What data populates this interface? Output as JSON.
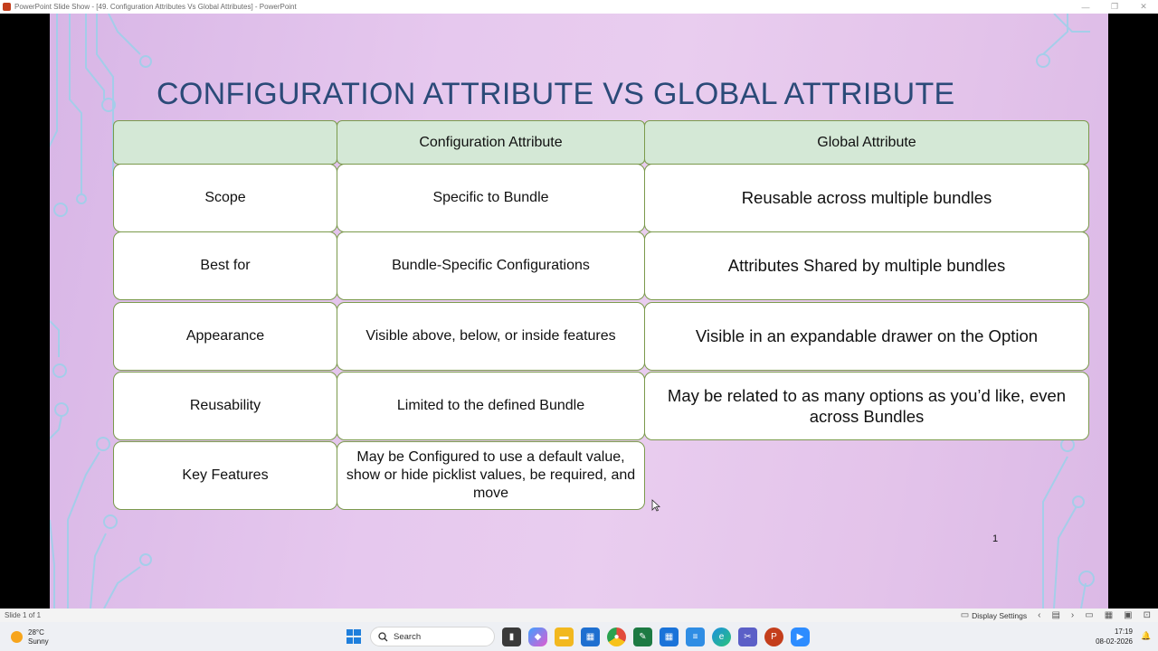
{
  "window": {
    "title": "PowerPoint Slide Show - [49. Configuration Attributes Vs Global Attributes] - PowerPoint",
    "min": "—",
    "max": "❐",
    "close": "✕"
  },
  "slide": {
    "title": "CONFIGURATION ATTRIBUTE VS GLOBAL ATTRIBUTE",
    "number": "1",
    "table": {
      "headers": [
        "",
        "Configuration Attribute",
        "Global Attribute"
      ],
      "rows": [
        {
          "label": "Scope",
          "config": "Specific to Bundle",
          "global": "Reusable across multiple bundles"
        },
        {
          "label": "Best for",
          "config": "Bundle-Specific Configurations",
          "global": "Attributes Shared by multiple bundles"
        },
        {
          "label": "Appearance",
          "config": "Visible above, below, or inside features",
          "global": "Visible in an expandable drawer on the Option"
        },
        {
          "label": "Reusability",
          "config": "Limited to the defined Bundle",
          "global": "May be related to as many options as you’d like, even across Bundles"
        },
        {
          "label": "Key Features",
          "config": "May be Configured to use a default value, show or hide picklist values, be required, and move",
          "global": ""
        }
      ]
    }
  },
  "statusbar": {
    "slide_of": "Slide 1 of 1",
    "display_settings": "Display Settings"
  },
  "taskbar": {
    "weather_temp": "28°C",
    "weather_desc": "Sunny",
    "search_label": "Search",
    "time": "17:19",
    "date": "08-02-2026"
  },
  "colors": {
    "title": "#2b4a78",
    "header_fill": "#d4e8d6",
    "cell_border": "#7b9a4c",
    "slide_bg": "#e6c8ee"
  }
}
